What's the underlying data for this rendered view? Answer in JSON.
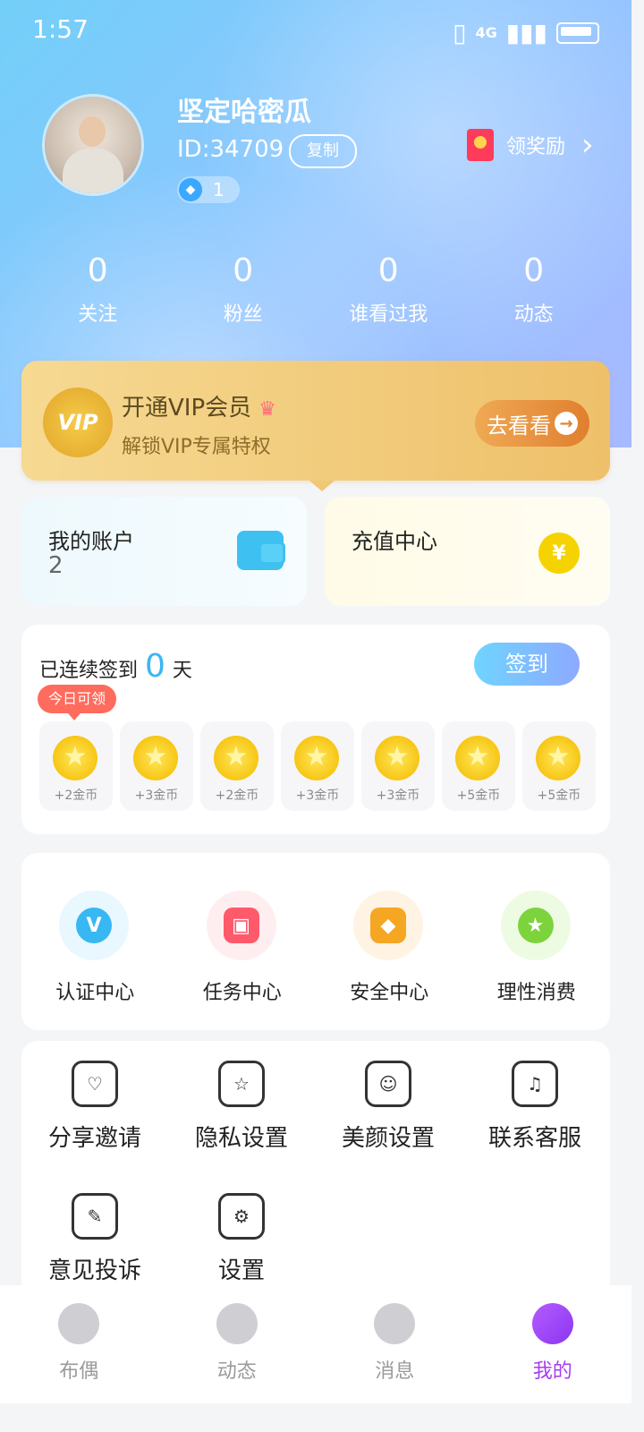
{
  "status": {
    "time": "1:57",
    "network": "4G"
  },
  "profile": {
    "nickname": "坚定哈密瓜",
    "uid": "ID:34709",
    "copy_label": "复制",
    "gems": "1",
    "reward_label": "领奖励"
  },
  "stats": [
    {
      "value": "0",
      "label": "关注"
    },
    {
      "value": "0",
      "label": "粉丝"
    },
    {
      "value": "0",
      "label": "谁看过我"
    },
    {
      "value": "0",
      "label": "动态"
    }
  ],
  "vip": {
    "title": "开通VIP会员",
    "subtitle": "解锁VIP专属特权",
    "button": "去看看",
    "badge": "VIP"
  },
  "account": {
    "title": "我的账户",
    "value": "2"
  },
  "recharge": {
    "title": "充值中心",
    "icon": "¥"
  },
  "signin": {
    "prefix": "已连续签到",
    "days": "0",
    "suffix": "天",
    "button": "签到",
    "today_tag": "今日可领",
    "rewards": [
      "+2金币",
      "+3金币",
      "+2金币",
      "+3金币",
      "+3金币",
      "+5金币",
      "+5金币"
    ]
  },
  "features": [
    {
      "label": "认证中心",
      "icon": "verified-icon",
      "color": "#38b8f2",
      "bg": "#e9f7ff",
      "glyph": "V"
    },
    {
      "label": "任务中心",
      "icon": "gift-icon",
      "color": "#ff5a6b",
      "bg": "#ffeef0",
      "glyph": "▣"
    },
    {
      "label": "安全中心",
      "icon": "shield-icon",
      "color": "#f5a623",
      "bg": "#fff3e3",
      "glyph": "◆"
    },
    {
      "label": "理性消费",
      "icon": "star-icon",
      "color": "#7dd33c",
      "bg": "#eefbe3",
      "glyph": "★"
    }
  ],
  "tools": [
    {
      "label": "分享邀请",
      "icon": "share-home-icon",
      "glyph": "♡"
    },
    {
      "label": "隐私设置",
      "icon": "privacy-star-icon",
      "glyph": "☆"
    },
    {
      "label": "美颜设置",
      "icon": "beauty-face-icon",
      "glyph": "☺"
    },
    {
      "label": "联系客服",
      "icon": "headset-icon",
      "glyph": "♫"
    },
    {
      "label": "意见投诉",
      "icon": "feedback-icon",
      "glyph": "✎"
    },
    {
      "label": "设置",
      "icon": "settings-gear-icon",
      "glyph": "⚙"
    }
  ],
  "tabs": [
    {
      "label": "布偶",
      "icon": "home-icon"
    },
    {
      "label": "动态",
      "icon": "planet-icon"
    },
    {
      "label": "消息",
      "icon": "message-icon"
    },
    {
      "label": "我的",
      "icon": "profile-icon",
      "active": true
    }
  ]
}
